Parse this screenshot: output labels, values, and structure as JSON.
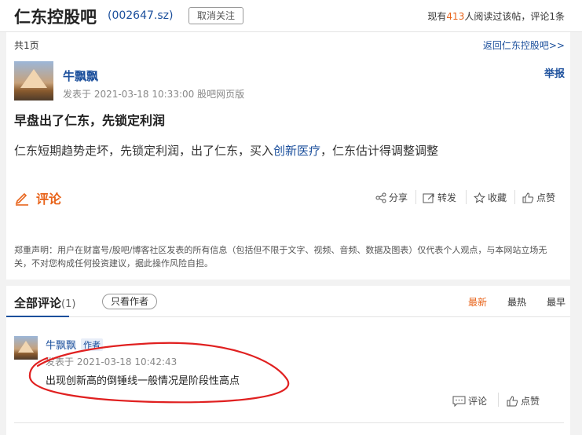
{
  "header": {
    "title": "仁东控股吧",
    "code": "(002647.sz)",
    "unfollow_label": "取消关注",
    "stats_prefix": "现有",
    "reads": "413",
    "stats_mid": "人阅读过该帖，评论",
    "comments": "1",
    "stats_suffix": "条"
  },
  "subheader": {
    "pages": "共1页",
    "back_link": "返回仁东控股吧>>"
  },
  "post": {
    "author": "牛飘飘",
    "meta": "发表于 2021-03-18 10:33:00 股吧网页版",
    "report": "举报",
    "title": "早盘出了仁东，先锁定利润",
    "body_pre": "仁东短期趋势走坏，先锁定利润，出了仁东，买入",
    "body_link": "创新医疗",
    "body_post": "，仁东估计得调整调整",
    "comment_label": "评论",
    "actions": {
      "share": "分享",
      "repost": "转发",
      "favorite": "收藏",
      "like": "点赞"
    },
    "disclaimer": "郑重声明：用户在财富号/股吧/博客社区发表的所有信息（包括但不限于文字、视频、音频、数据及图表）仅代表个人观点，与本网站立场无关，不对您构成任何投资建议，据此操作风险自担。"
  },
  "comments_section": {
    "title": "全部评论",
    "count": "(1)",
    "author_only": "只看作者",
    "sort": {
      "newest": "最新",
      "hottest": "最热",
      "earliest": "最早"
    }
  },
  "reply": {
    "author": "牛飘飘",
    "tag": "作者",
    "meta": "发表于 2021-03-18 10:42:43",
    "text": "出现创新高的倒锤线一般情况是阶段性高点",
    "comment": "评论",
    "like": "点赞"
  },
  "colors": {
    "accent": "#e8641b",
    "link": "#1b4f9c",
    "annotation": "#e02020"
  }
}
